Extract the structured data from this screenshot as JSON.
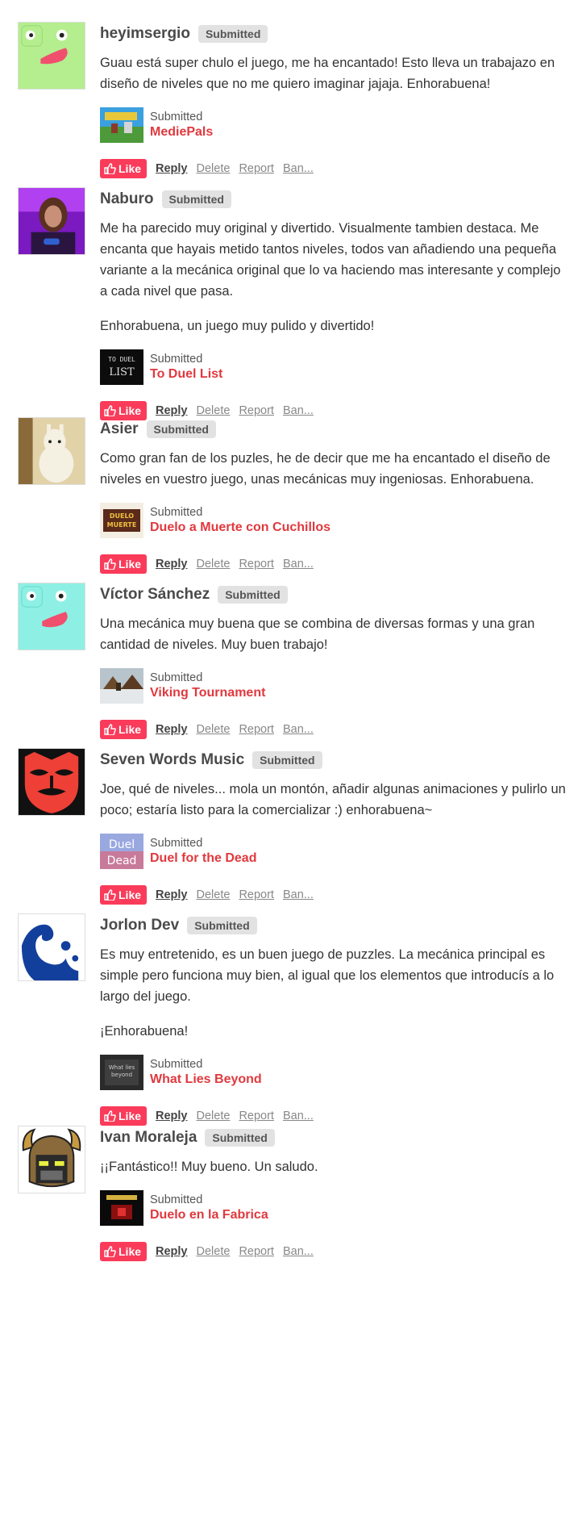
{
  "comment_labels": {
    "badge": "Submitted",
    "like": "Like",
    "reply": "Reply",
    "delete": "Delete",
    "report": "Report",
    "ban": "Ban..."
  },
  "comments": [
    {
      "author": "heyimsergio",
      "paragraphs": [
        "Guau está super chulo el juego, me ha encantado! Esto lleva un trabajazo en diseño de niveles que no me quiero imaginar jajaja. Enhorabuena!"
      ],
      "entry": {
        "status": "Submitted",
        "title": "MediePals"
      }
    },
    {
      "author": "Naburo",
      "paragraphs": [
        "Me ha parecido muy original y divertido. Visualmente tambien destaca. Me encanta que hayais metido tantos niveles, todos van añadiendo una pequeña variante a la mecánica original que lo va haciendo mas interesante y complejo a cada nivel que pasa.",
        "Enhorabuena, un juego muy pulido y divertido!"
      ],
      "entry": {
        "status": "Submitted",
        "title": "To Duel List"
      }
    },
    {
      "author": "Asier",
      "paragraphs": [
        "Como gran fan de los puzles, he de decir que me ha encantado el diseño de niveles en vuestro juego, unas mecánicas muy ingeniosas.  Enhorabuena."
      ],
      "entry": {
        "status": "Submitted",
        "title": "Duelo a Muerte con Cuchillos"
      }
    },
    {
      "author": "Víctor Sánchez",
      "paragraphs": [
        "Una mecánica muy buena que se combina de diversas formas y una gran cantidad de niveles. Muy buen trabajo!"
      ],
      "entry": {
        "status": "Submitted",
        "title": "Viking Tournament"
      }
    },
    {
      "author": "Seven Words Music",
      "paragraphs": [
        "Joe, qué de niveles... mola un montón, añadir algunas animaciones y pulirlo un poco; estaría listo para la comercializar :) enhorabuena~"
      ],
      "entry": {
        "status": "Submitted",
        "title": "Duel for the Dead"
      }
    },
    {
      "author": "Jorlon Dev",
      "paragraphs": [
        "Es muy entretenido, es un buen juego de puzzles. La mecánica principal es simple pero funciona muy bien, al igual que los elementos que introducís a lo largo del juego.",
        "¡Enhorabuena!"
      ],
      "entry": {
        "status": "Submitted",
        "title": "What Lies Beyond"
      }
    },
    {
      "author": "Ivan Moraleja",
      "paragraphs": [
        "¡¡Fantástico!! Muy bueno. Un saludo."
      ],
      "entry": {
        "status": "Submitted",
        "title": "Duelo en la Fabrica"
      }
    }
  ],
  "thumb_text": {
    "to_duel_list": [
      "TO DUEL",
      "LIST"
    ],
    "duelo_muerte": [
      "DUELO",
      "MUERTE"
    ],
    "duel_for_dead": [
      "Duel",
      "Dead"
    ],
    "what_lies": [
      "What lies",
      "beyond"
    ]
  },
  "colors": {
    "like_button": "#fa3b5a",
    "entry_title": "#e0393e",
    "badge_bg": "#e2e2e2",
    "author": "#4a4a4a",
    "frog_green": "#b4ee8e",
    "frog_cyan": "#8ef0e4",
    "mask_red": "#ee4036",
    "jorlon_blue": "#133f9c"
  }
}
